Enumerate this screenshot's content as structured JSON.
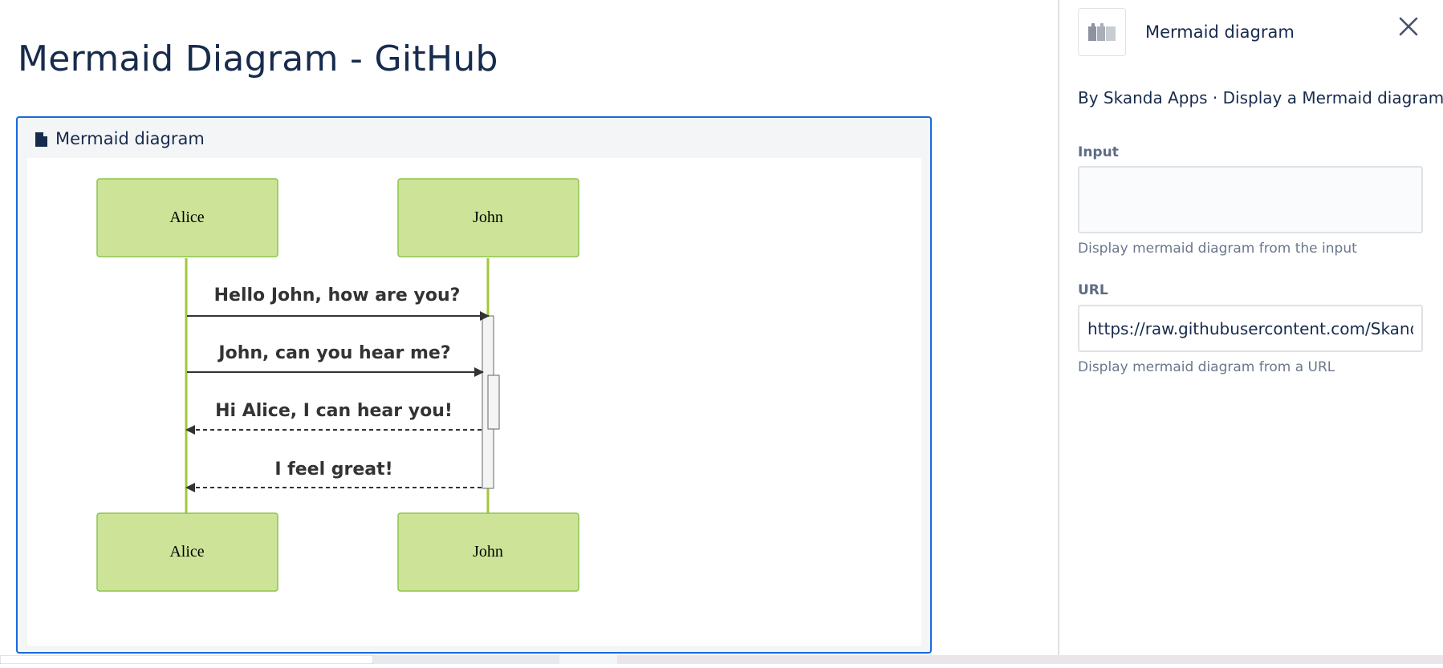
{
  "page": {
    "title": "Mermaid Diagram - GitHub"
  },
  "macro": {
    "header_label": "Mermaid diagram",
    "icon": "document-icon"
  },
  "diagram": {
    "type": "sequence",
    "participants": [
      "Alice",
      "John"
    ],
    "messages": [
      {
        "from": "Alice",
        "to": "John",
        "text": "Hello John, how are you?",
        "style": "solid"
      },
      {
        "from": "Alice",
        "to": "John",
        "text": "John, can you hear me?",
        "style": "solid"
      },
      {
        "from": "John",
        "to": "Alice",
        "text": "Hi Alice, I can hear you!",
        "style": "dashed"
      },
      {
        "from": "John",
        "to": "Alice",
        "text": "I feel great!",
        "style": "dashed"
      }
    ],
    "colors": {
      "actor_fill": "#cde498",
      "actor_border": "#8bc34a",
      "lifeline": "#a2c83a",
      "arrow": "#333333",
      "activation_fill": "#f4f4f4"
    }
  },
  "panel": {
    "app_name": "Mermaid diagram",
    "description": "By Skanda Apps · Display a Mermaid diagram.",
    "input": {
      "label": "Input",
      "value": "",
      "help": "Display mermaid diagram from the input"
    },
    "url": {
      "label": "URL",
      "value": "https://raw.githubusercontent.com/SkandaA",
      "help": "Display mermaid diagram from a URL"
    },
    "close_icon": "close-icon"
  },
  "colors": {
    "accent": "#1868db",
    "title": "#172b4d",
    "muted": "#6b778c"
  }
}
